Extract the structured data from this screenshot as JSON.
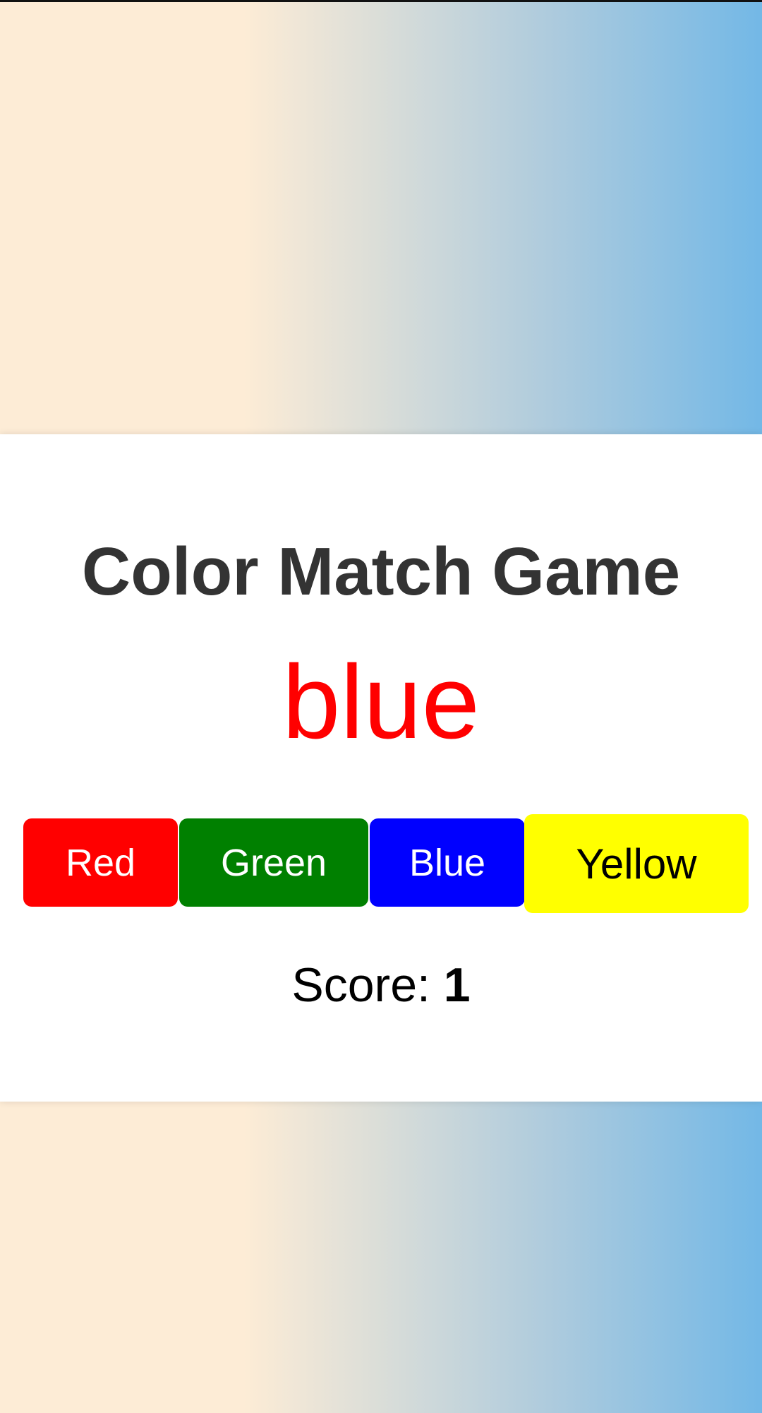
{
  "game": {
    "title": "Color Match Game",
    "target_word": "blue",
    "target_word_color": "#ff0000",
    "score_label": "Score: ",
    "score_value": "1"
  },
  "buttons": [
    {
      "label": "Red",
      "color": "#ff0000",
      "text_color": "#ffffff"
    },
    {
      "label": "Green",
      "color": "#008000",
      "text_color": "#ffffff"
    },
    {
      "label": "Blue",
      "color": "#0000ff",
      "text_color": "#ffffff"
    },
    {
      "label": "Yellow",
      "color": "#ffff00",
      "text_color": "#000000"
    }
  ],
  "background": {
    "gradient_start": "#fdecd6",
    "gradient_end": "#73b8e6"
  }
}
